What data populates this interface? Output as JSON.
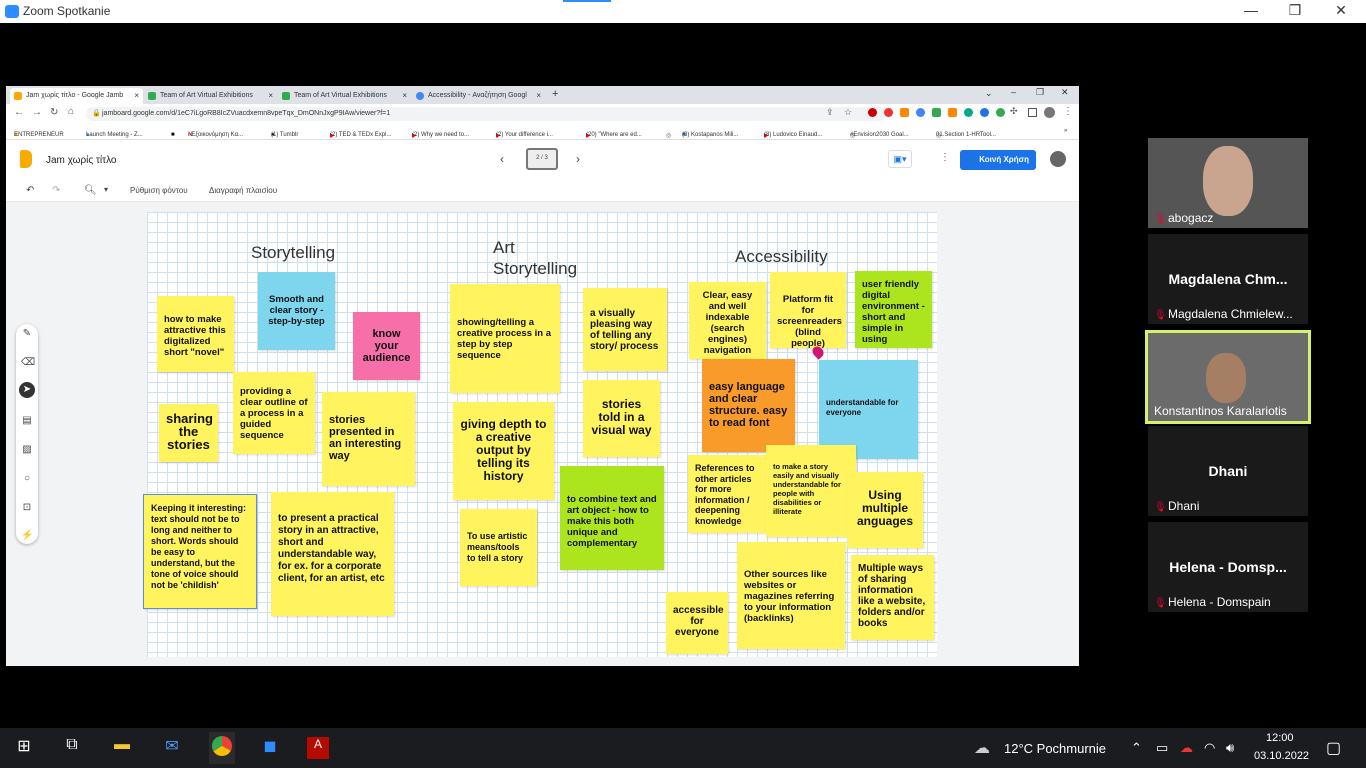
{
  "zoom": {
    "title": "Zoom Spotkanie",
    "minimize": "—",
    "restore": "❐",
    "close": "✕"
  },
  "browser": {
    "tabs": [
      "Jam χωρίς τίτλο - Google Jamb",
      "Team of Art Virtual Exhibitions",
      "Team of Art Virtual Exhibitions",
      "Accessibility - Αναζήτηση Googl"
    ],
    "new_tab": "+",
    "url": "jamboard.google.com/d/1eC7iLgoRB8IcZVuacdxemn8vpeTqx_DmONnJxgP9IAw/viewer?f=1",
    "bookmarks": [
      "ENTREPRENEUR",
      "Launch Meeting - Z...",
      "«Εξοικονόμηση Κα...",
      "(1) Tumblr",
      "(2) TED & TEDx Expl...",
      "(2) Why we need to...",
      "(2) Your difference i...",
      "(20) \"Where are ed...",
      "(3) Kostapanos Mili...",
      "(8) Ludovico Einaud...",
      "#Envision2030 Goal...",
      "01.Section 1-HRTool..."
    ]
  },
  "jam": {
    "title": "Jam χωρίς τίτλο",
    "frame_counter": "2 / 3",
    "share": "Κοινή Χρήση",
    "bg_label": "Ρύθμιση φόντου",
    "clear_label": "Διαγραφή πλαισίου"
  },
  "board": {
    "headings": [
      "Storytelling",
      "Art\nStorytelling",
      "Accessibility"
    ],
    "notes": [
      "how to make attractive this digitalized short \"novel\"",
      "Smooth and clear story - step-by-step",
      "know your audience",
      "sharing the stories",
      "providing a clear outline of a process in a guided sequence",
      "stories presented in an interesting way",
      "Keeping it interesting: text should not be to long and neither to short. Words should be easy to understand, but the tone of voice should not be 'childish'",
      "to present a practical story in an attractive, short and understandable way, for ex. for a corporate client, for an artist, etc",
      "showing/telling a creative process in a step by step sequence",
      "a visually pleasing way of telling any story/ process",
      "giving depth to a creative output by telling its history",
      "stories told in a visual way",
      "To use artistic means/tools to tell a story",
      "to combine text and art object - how to make this both unique and complementary",
      "Clear, easy and well indexable (search engines) navigation",
      "Platform fit for screenreaders (blind people)",
      "user friendly digital environment - short and simple in using",
      "easy language and clear structure. easy to read font",
      "understandable for everyone",
      "References to other articles for more information / deepening knowledge",
      "to make a story easily and visually understandable for people with disabilities or illiterate",
      "Using multiple anguages",
      "accessible for everyone",
      "Other sources like websites or magazines referring to your information (backlinks)",
      "Multiple ways of sharing information like a website, folders and/or books"
    ]
  },
  "participants": [
    {
      "label": "abogacz"
    },
    {
      "big": "Magdalena  Chm...",
      "label": "Magdalena Chmielew..."
    },
    {
      "label": "Konstantinos Karalariotis"
    },
    {
      "big": "Dhani",
      "label": "Dhani"
    },
    {
      "big": "Helena  -  Domsp...",
      "label": "Helena - Domspain"
    }
  ],
  "taskbar": {
    "weather": "12°C  Pochmurnie",
    "time": "12:00",
    "date": "03.10.2022"
  },
  "colors": {
    "yellow": "#fff35e",
    "blue": "#7dd6ee",
    "pink": "#f76fa8",
    "green": "#ace41d",
    "orange": "#f89b2b",
    "share_blue": "#1a73e8"
  }
}
